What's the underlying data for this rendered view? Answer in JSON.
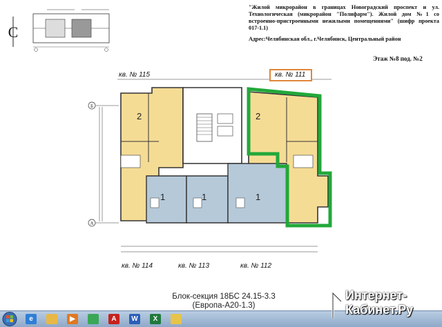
{
  "project_info": {
    "title": "\"Жилой микрорайон в границах Новоградский проспект и ул. Технологическая (микрорайон \"Полифарм\"). Жилой дом №1 со встроенно-пристроенными нежилыми помещениями\" (шифр проекта 017-1.1)",
    "address": "Адрес:Челябинская обл., г.Челябинск, Центральный район",
    "floor": "Этаж №8 под. №2"
  },
  "compass": {
    "letter": "С"
  },
  "apartments": [
    {
      "label": "кв. № 115",
      "color": "#f5dc95"
    },
    {
      "label": "кв. № 111",
      "color": "#f5dc95",
      "highlighted": true
    },
    {
      "label": "кв. № 114",
      "color": "#b5c9d9"
    },
    {
      "label": "кв. № 113",
      "color": "#b5c9d9"
    },
    {
      "label": "кв. № 112",
      "color": "#b5c9d9"
    }
  ],
  "room_marks": {
    "apt115": "2",
    "apt111": "2",
    "apt114": "1",
    "apt113": "1",
    "apt112": "1"
  },
  "axes": {
    "top": "Б",
    "bottom": "А"
  },
  "caption": {
    "line1": "Блок-секция 18БС 24.15-3.3",
    "line2": "(Европа-А20-1.3)"
  },
  "watermark": {
    "line1": "Интернет-",
    "line2": "Кабинет.Ру"
  },
  "colors": {
    "highlight_outline": "#22a83a",
    "label_box": "#e0863a",
    "living": "#f5dc95",
    "studio": "#b5c9d9"
  },
  "taskbar": {
    "apps": [
      {
        "name": "ie-icon",
        "glyph": "e",
        "color": "#2f7fd6"
      },
      {
        "name": "folder-icon",
        "glyph": "",
        "color": "#e8b846"
      },
      {
        "name": "media-player-icon",
        "glyph": "▶",
        "color": "#e07820"
      },
      {
        "name": "chrome-icon",
        "glyph": "",
        "color": "#3aa757"
      },
      {
        "name": "acrobat-icon",
        "glyph": "A",
        "color": "#c7211c"
      },
      {
        "name": "word-icon",
        "glyph": "W",
        "color": "#2b5eb8"
      },
      {
        "name": "excel-icon",
        "glyph": "X",
        "color": "#1f7a3c"
      },
      {
        "name": "image-viewer-icon",
        "glyph": "",
        "color": "#e6c34a"
      }
    ]
  }
}
